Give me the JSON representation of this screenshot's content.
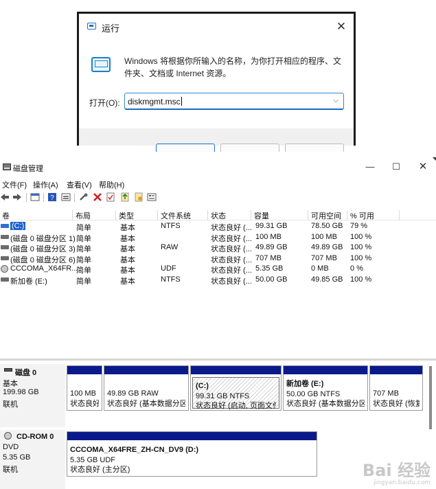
{
  "run_dialog": {
    "title": "运行",
    "description": "Windows 将根据你所输入的名称，为你打开相应的程序、文件夹、文档或 Internet 资源。",
    "open_label": "打开(O):",
    "input_value": "diskmgmt.msc"
  },
  "disk_mgmt": {
    "title": "磁盘管理",
    "menu": [
      "文件(F)",
      "操作(A)",
      "查看(V)",
      "帮助(H)"
    ],
    "toolbar_icons": [
      "back-icon",
      "forward-icon",
      "properties-icon",
      "help-icon",
      "view-icon",
      "connect-icon",
      "delete-icon",
      "check-icon",
      "rescan-icon",
      "open-icon",
      "explore-icon"
    ],
    "columns": [
      "卷",
      "布局",
      "类型",
      "文件系统",
      "状态",
      "容量",
      "可用空间",
      "% 可用"
    ],
    "volumes": [
      {
        "name": "(C:)",
        "layout": "简单",
        "type": "基本",
        "fs": "NTFS",
        "status": "状态良好 (...",
        "capacity": "99.31 GB",
        "free": "78.50 GB",
        "pct": "79 %",
        "selected": true
      },
      {
        "name": "(磁盘 0 磁盘分区 1)",
        "layout": "简单",
        "type": "基本",
        "fs": "",
        "status": "状态良好 (...",
        "capacity": "100 MB",
        "free": "100 MB",
        "pct": "100 %"
      },
      {
        "name": "(磁盘 0 磁盘分区 3)",
        "layout": "简单",
        "type": "基本",
        "fs": "RAW",
        "status": "状态良好 (...",
        "capacity": "49.89 GB",
        "free": "49.89 GB",
        "pct": "100 %"
      },
      {
        "name": "(磁盘 0 磁盘分区 6)",
        "layout": "简单",
        "type": "基本",
        "fs": "",
        "status": "状态良好 (...",
        "capacity": "707 MB",
        "free": "707 MB",
        "pct": "100 %"
      },
      {
        "name": "CCCOMA_X64FR...",
        "layout": "简单",
        "type": "基本",
        "fs": "UDF",
        "status": "状态良好 (...",
        "capacity": "5.35 GB",
        "free": "0 MB",
        "pct": "0 %"
      },
      {
        "name": "新加卷 (E:)",
        "layout": "简单",
        "type": "基本",
        "fs": "NTFS",
        "status": "状态良好 (...",
        "capacity": "50.00 GB",
        "free": "49.85 GB",
        "pct": "100 %"
      }
    ],
    "disk0": {
      "name": "磁盘 0",
      "type": "基本",
      "size": "199.98 GB",
      "state": "联机",
      "partitions": [
        {
          "title": "",
          "line1": "100 MB",
          "line2": "状态良好"
        },
        {
          "title": "",
          "line1": "49.89 GB RAW",
          "line2": "状态良好 (基本数据分区)"
        },
        {
          "title": "(C:)",
          "line1": "99.31 GB NTFS",
          "line2": "状态良好 (启动, 页面文件,"
        },
        {
          "title": "新加卷  (E:)",
          "line1": "50.00 GB NTFS",
          "line2": "状态良好 (基本数据分区)"
        },
        {
          "title": "",
          "line1": "707 MB",
          "line2": "状态良好 (恢复"
        }
      ]
    },
    "cdrom0": {
      "name": "CD-ROM 0",
      "type": "DVD",
      "size": "5.35 GB",
      "state": "联机",
      "partition": {
        "title": "CCCOMA_X64FRE_ZH-CN_DV9  (D:)",
        "line1": "5.35 GB UDF",
        "line2": "状态良好 (主分区)"
      }
    }
  },
  "watermark": {
    "main": "Bai 经验",
    "sub": "jingyan.baidu.com"
  }
}
